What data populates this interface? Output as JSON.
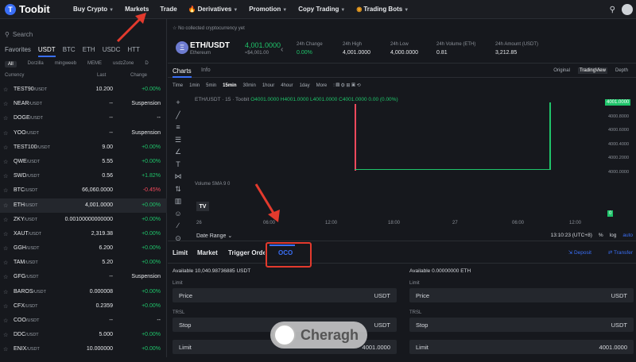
{
  "nav": {
    "logo": "Toobit",
    "items": [
      {
        "label": "Buy Crypto",
        "caret": true
      },
      {
        "label": "Markets",
        "caret": false
      },
      {
        "label": "Trade",
        "caret": false
      },
      {
        "label": "Derivatives",
        "caret": true,
        "icon": "fire-icon"
      },
      {
        "label": "Promotion",
        "caret": true
      },
      {
        "label": "Copy Trading",
        "caret": true
      },
      {
        "label": "Trading Bots",
        "caret": true,
        "icon": "bot-icon"
      }
    ]
  },
  "sidebar": {
    "search_placeholder": "Search",
    "tabs": [
      "Favorites",
      "USDT",
      "BTC",
      "ETH",
      "USDC",
      "HTT"
    ],
    "active_tab": "USDT",
    "subtabs": [
      "All",
      "Dorzilla",
      "mingweeb",
      "MEME",
      "usdzZone",
      "D"
    ],
    "active_subtab": "All",
    "col_currency": "Currency",
    "col_last": "Last",
    "col_change": "Change",
    "rows": [
      {
        "base": "TEST90",
        "quote": "/USDT",
        "last": "10.200",
        "change": "+0.00%",
        "dir": "pos"
      },
      {
        "base": "NEAR",
        "quote": "/USDT",
        "last": "--",
        "change": "Suspension",
        "dir": "neu"
      },
      {
        "base": "DOGE",
        "quote": "/USDT",
        "last": "--",
        "change": "--",
        "dir": "neu"
      },
      {
        "base": "YOO",
        "quote": "/USDT",
        "last": "--",
        "change": "Suspension",
        "dir": "neu"
      },
      {
        "base": "TEST100",
        "quote": "/USDT",
        "last": "9.00",
        "change": "+0.00%",
        "dir": "pos"
      },
      {
        "base": "QWE",
        "quote": "/USDT",
        "last": "5.55",
        "change": "+0.00%",
        "dir": "pos"
      },
      {
        "base": "SWD",
        "quote": "/USDT",
        "last": "0.56",
        "change": "+1.82%",
        "dir": "pos"
      },
      {
        "base": "BTC",
        "quote": "/USDT",
        "last": "66,060.0000",
        "change": "-0.45%",
        "dir": "neg"
      },
      {
        "base": "ETH",
        "quote": "/USDT",
        "last": "4,001.0000",
        "change": "+0.00%",
        "dir": "pos",
        "selected": true
      },
      {
        "base": "ZKY",
        "quote": "/USDT",
        "last": "0.00100000000000",
        "change": "+0.00%",
        "dir": "pos"
      },
      {
        "base": "XAUT",
        "quote": "/USDT",
        "last": "2,319.38",
        "change": "+0.00%",
        "dir": "pos"
      },
      {
        "base": "GGH",
        "quote": "/USDT",
        "last": "6.200",
        "change": "+0.00%",
        "dir": "pos"
      },
      {
        "base": "TAM",
        "quote": "/USDT",
        "last": "5.20",
        "change": "+0.00%",
        "dir": "pos"
      },
      {
        "base": "GFG",
        "quote": "/USDT",
        "last": "--",
        "change": "Suspension",
        "dir": "neu"
      },
      {
        "base": "BAROS",
        "quote": "/USDT",
        "last": "0.000008",
        "change": "+0.00%",
        "dir": "pos"
      },
      {
        "base": "CFX",
        "quote": "/USDT",
        "last": "0.2359",
        "change": "+0.00%",
        "dir": "pos"
      },
      {
        "base": "COO",
        "quote": "/USDT",
        "last": "--",
        "change": "--",
        "dir": "neu"
      },
      {
        "base": "DDC",
        "quote": "/USDT",
        "last": "5.000",
        "change": "+0.00%",
        "dir": "pos"
      },
      {
        "base": "ENIX",
        "quote": "/USDT",
        "last": "10.000000",
        "change": "+0.00%",
        "dir": "pos"
      }
    ]
  },
  "notice": "No collected cryptocurrency yet",
  "ticker": {
    "pair": "ETH/USDT",
    "name": "Ethereum",
    "price": "4,001.0000",
    "price_usd": "≈$4,001.00",
    "stats": [
      {
        "label": "24h Change",
        "value": "0.00%",
        "color": "#1fc46a"
      },
      {
        "label": "24h High",
        "value": "4,001.0000"
      },
      {
        "label": "24h Low",
        "value": "4,000.0000"
      },
      {
        "label": "24h Volume (ETH)",
        "value": "0.81"
      },
      {
        "label": "24h Amount (USDT)",
        "value": "3,212.85"
      }
    ]
  },
  "chart_header": {
    "tab_charts": "Charts",
    "tab_info": "Info",
    "views": [
      "Original",
      "TradingView",
      "Depth"
    ],
    "active_view": "TradingView"
  },
  "timeframes": [
    "Time",
    "1min",
    "5min",
    "15min",
    "30min",
    "1hour",
    "4hour",
    "1day",
    "More"
  ],
  "active_timeframe": "15min",
  "chart_legend": {
    "title": "ETH/USDT · 15 · Toobit",
    "ohlc": "O4001.0000 H4001.0000 L4001.0000 C4001.0000 0.00 (0.00%)"
  },
  "chart_data": {
    "type": "line",
    "title": "ETH/USDT · 15 · Toobit",
    "y_ticks": [
      "4001.0000",
      "4000.8000",
      "4000.6000",
      "4000.4000",
      "4000.2000",
      "4000.0000"
    ],
    "last_price_label": "4001.0000",
    "x_ticks": [
      "26",
      "06:00",
      "12:00",
      "18:00",
      "27",
      "06:00",
      "12:00"
    ],
    "volume_label": "Volume SMA 9",
    "volume_value": "0"
  },
  "date_range": {
    "label": "Date Range",
    "time": "13:10:23 (UTC+8)",
    "pct": "%",
    "log": "log",
    "auto": "auto"
  },
  "order_tabs": [
    "Limit",
    "Market",
    "Trigger Order",
    "OCO"
  ],
  "active_order_tab": "OCO",
  "links": {
    "deposit": "Deposit",
    "transfer": "Transfer"
  },
  "buy_form": {
    "available": "Available 10,040.98736885 USDT",
    "limit_label": "Limit",
    "price_field": "Price",
    "price_unit": "USDT",
    "trsl_label": "TRSL",
    "stop_field": "Stop",
    "stop_unit": "USDT",
    "last_field": "Limit",
    "last_value": "4001.0000"
  },
  "sell_form": {
    "available": "Available 0.00000000 ETH",
    "limit_label": "Limit",
    "price_field": "Price",
    "price_unit": "USDT",
    "trsl_label": "TRSL",
    "stop_field": "Stop",
    "stop_unit": "USDT",
    "last_field": "Limit",
    "last_value": "4001.0000"
  },
  "watermark": "Cheragh"
}
